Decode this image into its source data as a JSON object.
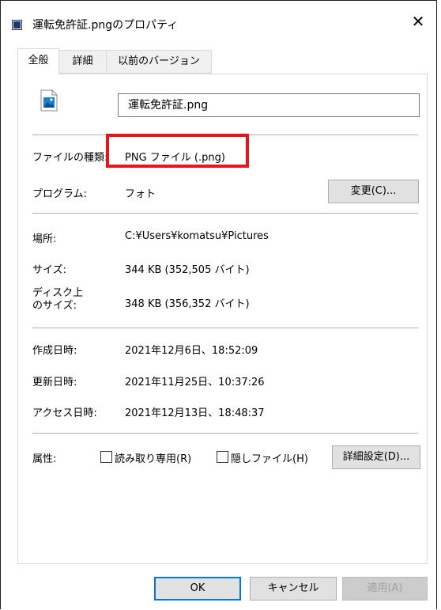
{
  "window": {
    "title": "運転免許証.pngのプロパティ",
    "close_glyph": "✕"
  },
  "tabs": [
    {
      "label": "全般",
      "active": true
    },
    {
      "label": "詳細"
    },
    {
      "label": "以前のバージョン"
    }
  ],
  "file": {
    "name": "運転免許証.png",
    "icon": "image-file-icon"
  },
  "fields": {
    "type_label": "ファイルの種類:",
    "type_value": "PNG ファイル (.png)",
    "program_label": "プログラム:",
    "program_value": "フォト",
    "change_button": "変更(C)...",
    "location_label": "場所:",
    "location_value": "C:¥Users¥komatsu¥Pictures",
    "size_label": "サイズ:",
    "size_value": "344 KB (352,505 バイト)",
    "disk_size_label_1": "ディスク上",
    "disk_size_label_2": "のサイズ:",
    "disk_size_value": "348 KB (356,352 バイト)",
    "created_label": "作成日時:",
    "created_value": "2021年12月6日、18:52:09",
    "modified_label": "更新日時:",
    "modified_value": "2021年11月25日、10:37:26",
    "accessed_label": "アクセス日時:",
    "accessed_value": "2021年12月13日、18:48:37",
    "attributes_label": "属性:",
    "readonly_label": "読み取り専用(R)",
    "readonly_checked": false,
    "hidden_label": "隠しファイル(H)",
    "hidden_checked": false,
    "advanced_button": "詳細設定(D)..."
  },
  "footer": {
    "ok": "OK",
    "cancel": "キャンセル",
    "apply": "適用(A)"
  },
  "colors": {
    "highlight": "#e8141c",
    "default_button_border": "#0078d7"
  }
}
